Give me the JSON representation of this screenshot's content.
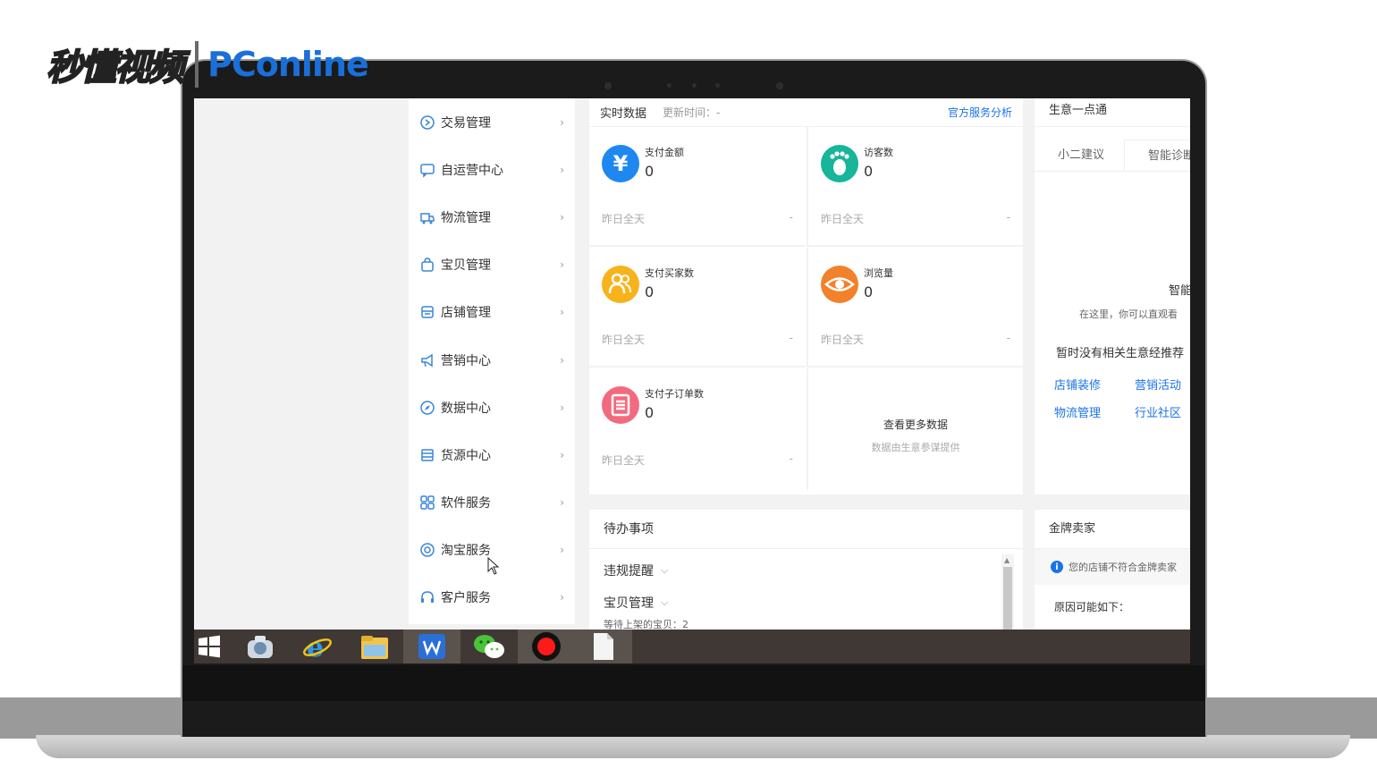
{
  "watermark": {
    "left_text": "秒懂视频",
    "right_text": "PConline"
  },
  "sidebar": {
    "items": [
      {
        "label": "交易管理",
        "icon": "trade-icon"
      },
      {
        "label": "自运营中心",
        "icon": "chat-icon"
      },
      {
        "label": "物流管理",
        "icon": "truck-icon"
      },
      {
        "label": "宝贝管理",
        "icon": "bag-icon"
      },
      {
        "label": "店铺管理",
        "icon": "store-icon"
      },
      {
        "label": "营销中心",
        "icon": "megaphone-icon"
      },
      {
        "label": "数据中心",
        "icon": "compass-icon"
      },
      {
        "label": "货源中心",
        "icon": "box-icon"
      },
      {
        "label": "软件服务",
        "icon": "apps-icon"
      },
      {
        "label": "淘宝服务",
        "icon": "service-icon"
      },
      {
        "label": "客户服务",
        "icon": "headset-icon"
      }
    ]
  },
  "realtime": {
    "title": "实时数据",
    "update_label": "更新时间：-",
    "link": "官方服务分析",
    "metrics": [
      {
        "label": "支付金额",
        "value": "0",
        "foot": "昨日全天",
        "dash": "-",
        "icon": "yuan-icon",
        "icon_glyph": "¥",
        "color": "#1e88f0"
      },
      {
        "label": "访客数",
        "value": "0",
        "foot": "昨日全天",
        "dash": "-",
        "icon": "footprint-icon",
        "icon_glyph": "",
        "color": "#17b59a"
      },
      {
        "label": "支付买家数",
        "value": "0",
        "foot": "昨日全天",
        "dash": "-",
        "icon": "users-icon",
        "icon_glyph": "",
        "color": "#f7b31b"
      },
      {
        "label": "浏览量",
        "value": "0",
        "foot": "昨日全天",
        "dash": "-",
        "icon": "eye-icon",
        "icon_glyph": "",
        "color": "#f2812b"
      },
      {
        "label": "支付子订单数",
        "value": "0",
        "foot": "昨日全天",
        "dash": "-",
        "icon": "order-list-icon",
        "icon_glyph": "",
        "color": "#f26a7e"
      }
    ],
    "more_title": "查看更多数据",
    "more_sub": "数据由生意参谋提供"
  },
  "business": {
    "title": "生意一点通",
    "tabs": [
      "小二建议",
      "智能诊断"
    ],
    "smart": "智能",
    "desc": "在这里，你可以直观看",
    "none": "暂时没有相关生意经推荐",
    "links": [
      "店铺装修",
      "营销活动",
      "物流管理",
      "行业社区"
    ]
  },
  "todo": {
    "title": "待办事项",
    "rows": [
      "违规提醒",
      "宝贝管理"
    ],
    "cut": "等待上架的宝贝：2"
  },
  "gold": {
    "title": "金牌卖家",
    "notice": "您的店铺不符合金牌卖家",
    "reason": "原因可能如下："
  },
  "taskbar": {
    "items": [
      "windows-start-icon",
      "explorer-icon",
      "ie-icon",
      "folder-icon",
      "wps-icon",
      "wechat-icon",
      "record-icon",
      "document-icon"
    ]
  }
}
